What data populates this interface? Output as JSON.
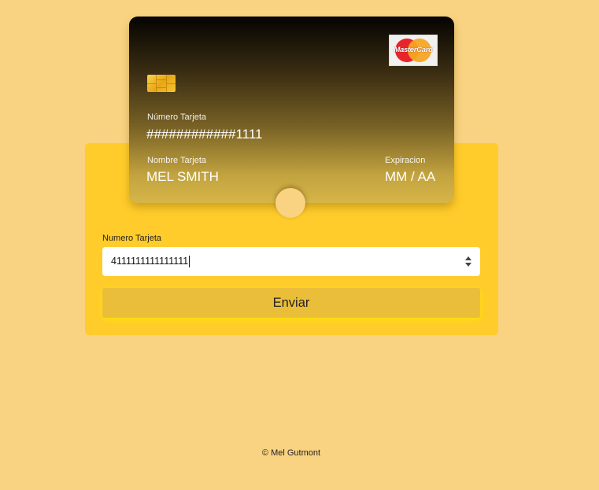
{
  "card": {
    "brand_text": "MasterCard",
    "brand_icon": "mastercard-logo",
    "chip_icon": "chip-icon",
    "number_label": "Número Tarjeta",
    "number_value": "############1111",
    "name_label": "Nombre Tarjeta",
    "name_value": "MEL SMITH",
    "expiry_label": "Expiracion",
    "expiry_value": "MM / AA"
  },
  "form": {
    "number_label": "Numero Tarjeta",
    "number_value": "4111111111111111",
    "submit_label": "Enviar"
  },
  "footer": {
    "text": "© Mel Gutmont"
  },
  "colors": {
    "page_background": "#f9d381",
    "panel_background": "#ffcc2b",
    "button_background": "#ebbe3a"
  }
}
